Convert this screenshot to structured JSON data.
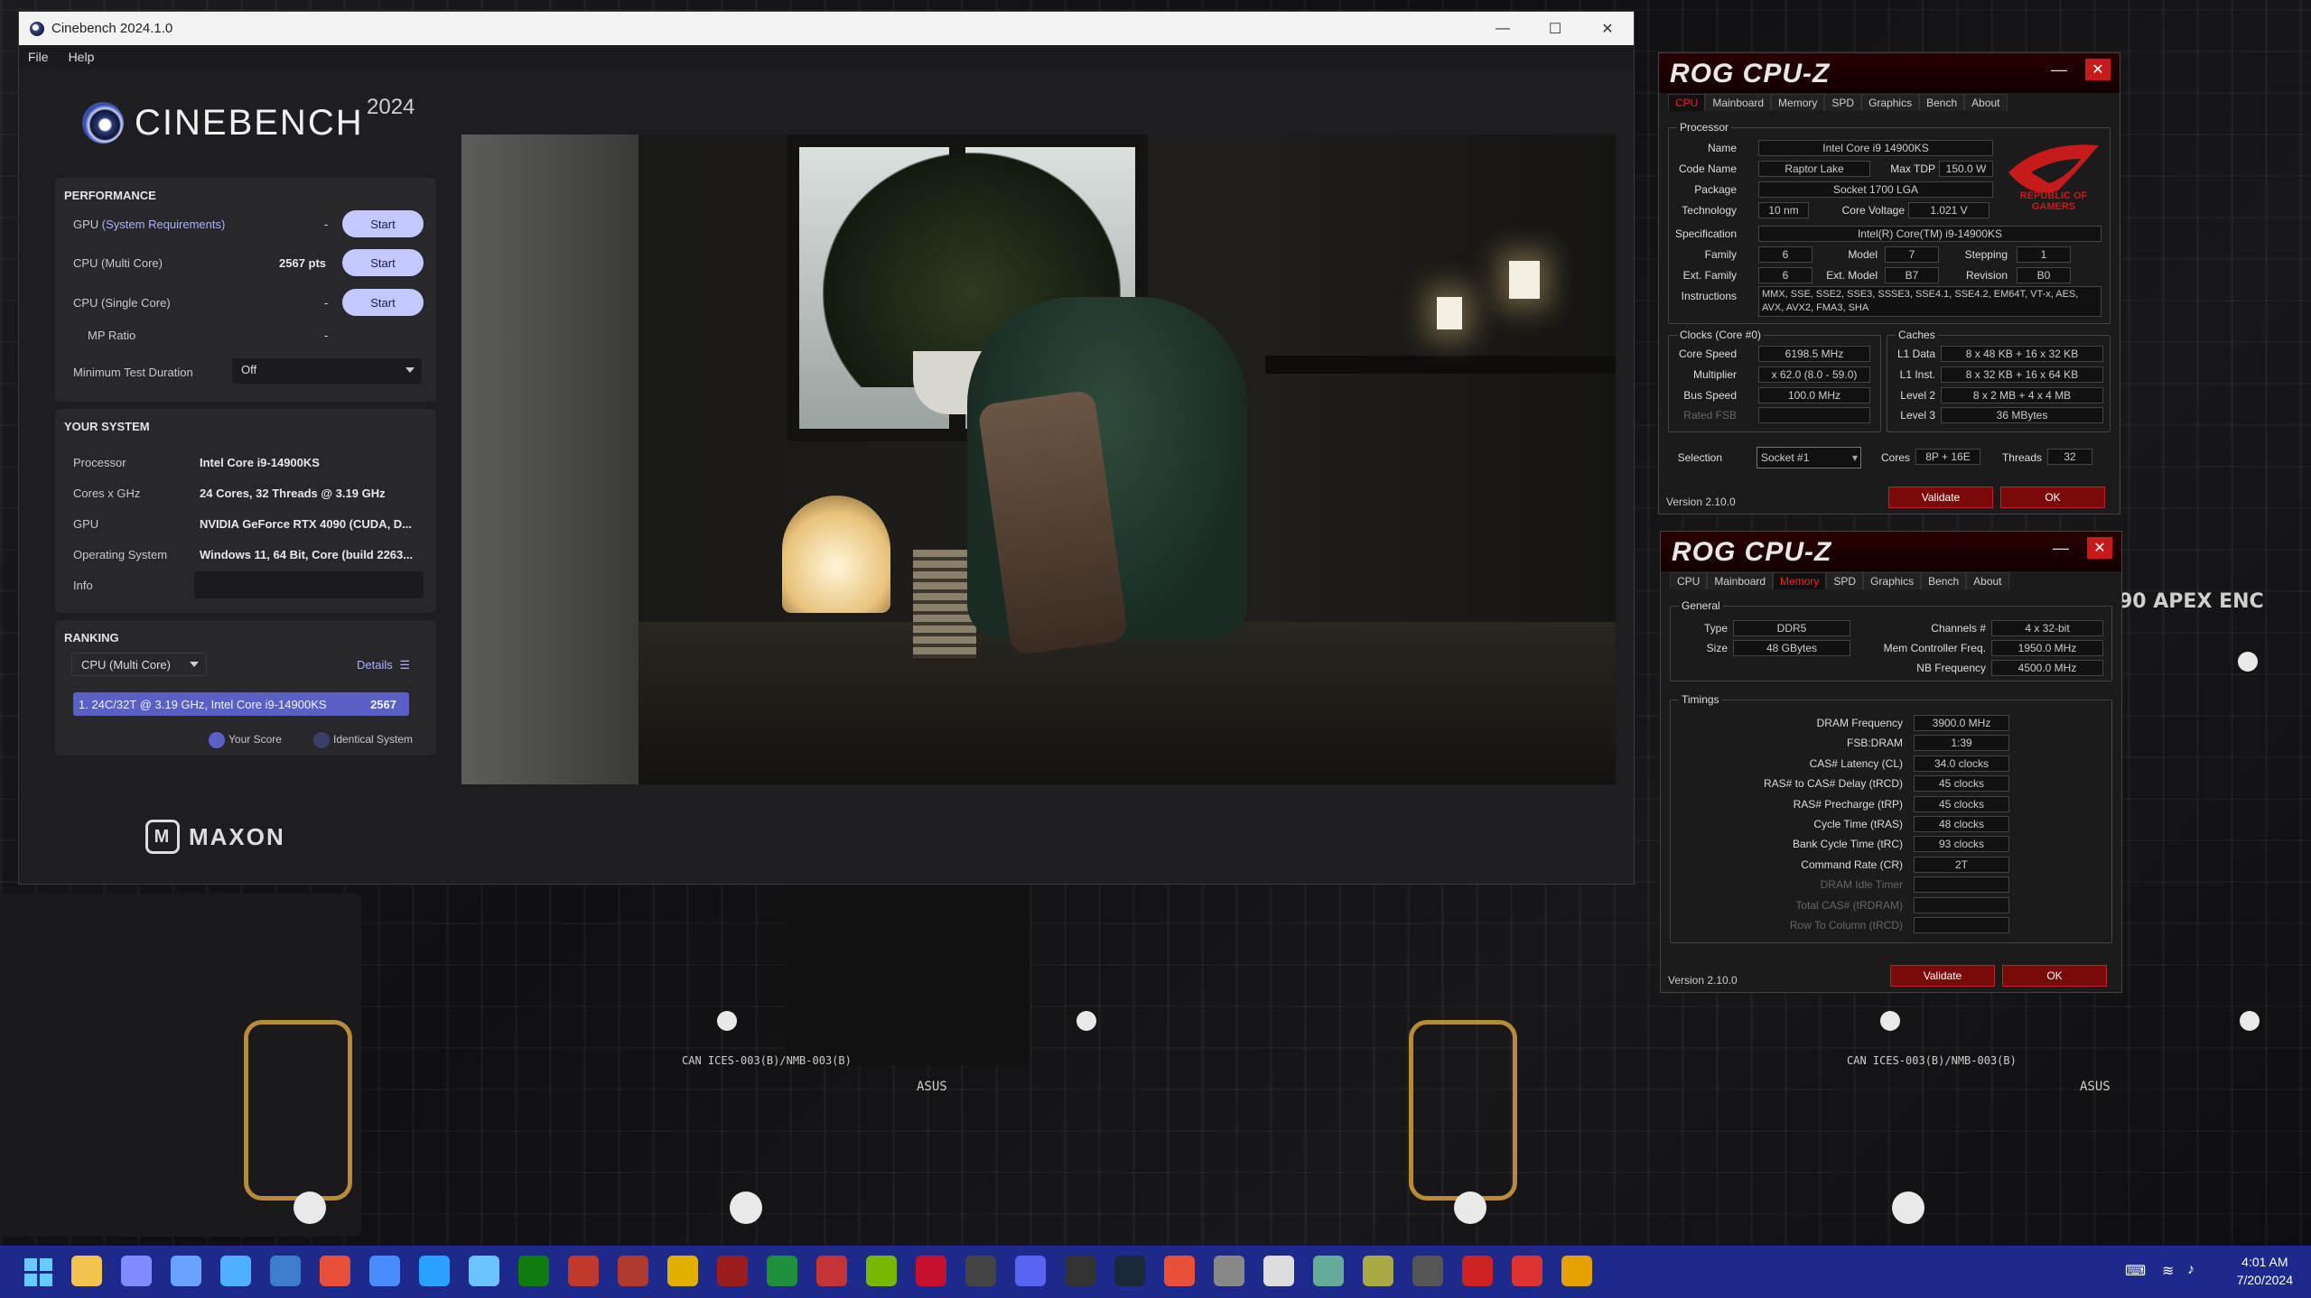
{
  "cinebench": {
    "window_title": "Cinebench 2024.1.0",
    "menu": [
      "File",
      "Help"
    ],
    "brand": "CINEBENCH",
    "year": "2024",
    "performance": {
      "header": "PERFORMANCE",
      "gpu_label": "GPU",
      "gpu_link": "(System Requirements)",
      "gpu_score": "-",
      "multi_label": "CPU (Multi Core)",
      "multi_score": "2567 pts",
      "single_label": "CPU (Single Core)",
      "single_score": "-",
      "mp_label": "MP Ratio",
      "mp_value": "-",
      "start": "Start",
      "min_duration_label": "Minimum Test Duration",
      "min_duration_value": "Off"
    },
    "system": {
      "header": "YOUR SYSTEM",
      "rows": [
        {
          "label": "Processor",
          "value": "Intel Core i9-14900KS"
        },
        {
          "label": "Cores x GHz",
          "value": "24 Cores, 32 Threads @ 3.19 GHz"
        },
        {
          "label": "GPU",
          "value": "NVIDIA GeForce RTX 4090 (CUDA, D..."
        },
        {
          "label": "Operating System",
          "value": "Windows 11, 64 Bit, Core (build 2263..."
        },
        {
          "label": "Info",
          "value": ""
        }
      ]
    },
    "ranking": {
      "header": "RANKING",
      "select": "CPU (Multi Core)",
      "details": "Details",
      "entry": "1. 24C/32T @ 3.19 GHz, Intel Core i9-14900KS",
      "entry_score": "2567",
      "legend_your": "Your Score",
      "legend_identical": "Identical System"
    },
    "footer_brand": "MAXON"
  },
  "cpuz_cpu": {
    "brand": "ROG CPU-Z",
    "tabs": [
      "CPU",
      "Mainboard",
      "Memory",
      "SPD",
      "Graphics",
      "Bench",
      "About"
    ],
    "active_tab": "CPU",
    "processor_group": "Processor",
    "name_label": "Name",
    "name": "Intel Core i9 14900KS",
    "code_label": "Code Name",
    "code": "Raptor Lake",
    "tdp_label": "Max TDP",
    "tdp": "150.0 W",
    "package_label": "Package",
    "package": "Socket 1700 LGA",
    "tech_label": "Technology",
    "tech": "10 nm",
    "volt_label": "Core Voltage",
    "volt": "1.021 V",
    "spec_label": "Specification",
    "spec": "Intel(R) Core(TM) i9-14900KS",
    "family_label": "Family",
    "family": "6",
    "model_label": "Model",
    "model": "7",
    "stepping_label": "Stepping",
    "stepping": "1",
    "extfam_label": "Ext. Family",
    "extfam": "6",
    "extmodel_label": "Ext. Model",
    "extmodel": "B7",
    "rev_label": "Revision",
    "rev": "B0",
    "instr_label": "Instructions",
    "instr": "MMX, SSE, SSE2, SSE3, SSSE3, SSE4.1, SSE4.2, EM64T, VT-x, AES, AVX, AVX2, FMA3, SHA",
    "clocks_group": "Clocks (Core #0)",
    "caches_group": "Caches",
    "core_speed_label": "Core Speed",
    "core_speed": "6198.5 MHz",
    "mult_label": "Multiplier",
    "mult": "x 62.0 (8.0 - 59.0)",
    "bus_label": "Bus Speed",
    "bus": "100.0 MHz",
    "fsb_label": "Rated FSB",
    "l1d_label": "L1 Data",
    "l1d": "8 x 48 KB + 16 x 32 KB",
    "l1i_label": "L1 Inst.",
    "l1i": "8 x 32 KB + 16 x 64 KB",
    "l2_label": "Level 2",
    "l2": "8 x 2 MB + 4 x 4 MB",
    "l3_label": "Level 3",
    "l3": "36 MBytes",
    "sel_label": "Selection",
    "sel": "Socket #1",
    "cores_label": "Cores",
    "cores": "8P + 16E",
    "threads_label": "Threads",
    "threads": "32",
    "version": "Version 2.10.0",
    "validate": "Validate",
    "ok": "OK",
    "rog_text": "REPUBLIC OF GAMERS"
  },
  "cpuz_mem": {
    "brand": "ROG CPU-Z",
    "tabs": [
      "CPU",
      "Mainboard",
      "Memory",
      "SPD",
      "Graphics",
      "Bench",
      "About"
    ],
    "active_tab": "Memory",
    "general_group": "General",
    "type_label": "Type",
    "type": "DDR5",
    "size_label": "Size",
    "size": "48 GBytes",
    "channels_label": "Channels #",
    "channels": "4 x 32-bit",
    "mcf_label": "Mem Controller Freq.",
    "mcf": "1950.0 MHz",
    "nb_label": "NB Frequency",
    "nb": "4500.0 MHz",
    "timings_group": "Timings",
    "timings": [
      {
        "label": "DRAM Frequency",
        "value": "3900.0 MHz"
      },
      {
        "label": "FSB:DRAM",
        "value": "1:39"
      },
      {
        "label": "CAS# Latency (CL)",
        "value": "34.0 clocks"
      },
      {
        "label": "RAS# to CAS# Delay (tRCD)",
        "value": "45 clocks"
      },
      {
        "label": "RAS# Precharge (tRP)",
        "value": "45 clocks"
      },
      {
        "label": "Cycle Time (tRAS)",
        "value": "48 clocks"
      },
      {
        "label": "Bank Cycle Time (tRC)",
        "value": "93 clocks"
      },
      {
        "label": "Command Rate (CR)",
        "value": "2T"
      },
      {
        "label": "DRAM Idle Timer",
        "value": ""
      },
      {
        "label": "Total CAS# (tRDRAM)",
        "value": ""
      },
      {
        "label": "Row To Column (tRCD)",
        "value": ""
      }
    ],
    "version": "Version 2.10.0",
    "validate": "Validate",
    "ok": "OK"
  },
  "desktop": {
    "board_text_1": "90 APEX ENC",
    "board_text_2": "CAN ICES-003(B)/NMB-003(B)",
    "board_text_3": "ASUS"
  },
  "taskbar": {
    "time": "4:01 AM",
    "date": "7/20/2024",
    "icons": [
      "start",
      "file-explorer",
      "settings",
      "task-manager",
      "photos",
      "calculator",
      "chrome",
      "store",
      "paint",
      "notepad",
      "xbox",
      "hwinfo",
      "aida",
      "bm",
      "cpuz",
      "xbox-app",
      "aida64",
      "nvidia",
      "gpu-z",
      "terminal",
      "discord",
      "obs",
      "steam",
      "chrome-alt",
      "app",
      "gear",
      "app2",
      "app3",
      "app4",
      "app5",
      "firefox-alt",
      "cinebench"
    ],
    "colors": {
      "bg": "#1d2a8c",
      "accent": "#c3c9ff",
      "rank": "#5a5fc6",
      "rog_red": "#c61b1b"
    }
  }
}
